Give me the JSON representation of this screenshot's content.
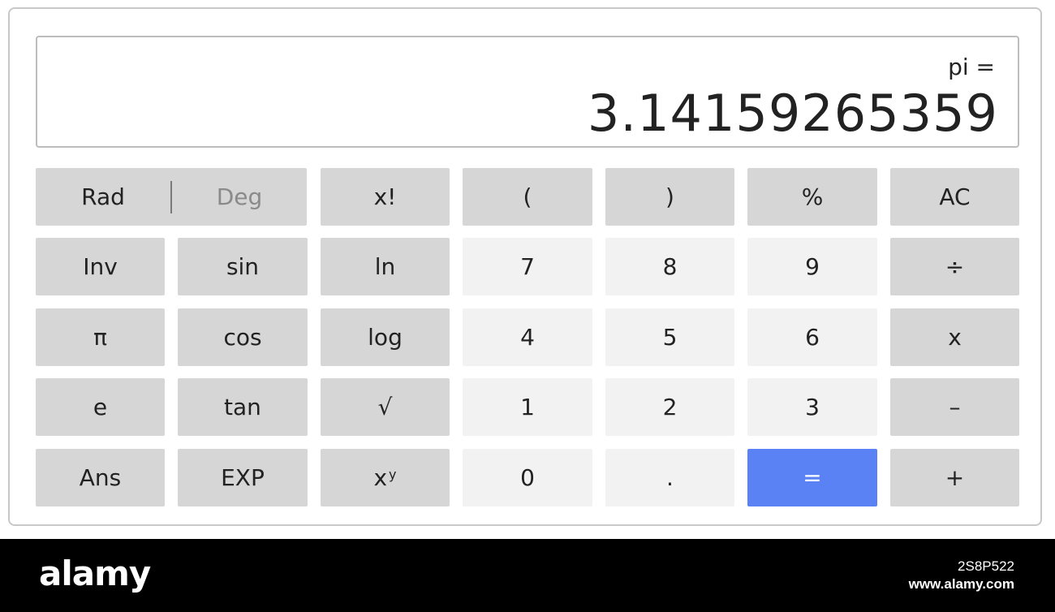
{
  "display": {
    "expression": "pi =",
    "result": "3.14159265359"
  },
  "angle_mode": {
    "rad_label": "Rad",
    "deg_label": "Deg"
  },
  "keys": {
    "factorial": "x!",
    "open_paren": "(",
    "close_paren": ")",
    "percent": "%",
    "clear": "AC",
    "inv": "Inv",
    "sin": "sin",
    "ln": "ln",
    "seven": "7",
    "eight": "8",
    "nine": "9",
    "divide": "÷",
    "pi": "π",
    "cos": "cos",
    "log": "log",
    "four": "4",
    "five": "5",
    "six": "6",
    "multiply": "x",
    "e": "e",
    "tan": "tan",
    "sqrt": "√",
    "one": "1",
    "two": "2",
    "three": "3",
    "minus": "–",
    "ans": "Ans",
    "exp": "EXP",
    "power_base": "x",
    "power_sup": "y",
    "zero": "0",
    "decimal": ".",
    "equals": "=",
    "plus": "+"
  },
  "watermark": {
    "brand": "alamy",
    "image_code": "2S8P522",
    "url": "www.alamy.com"
  },
  "colors": {
    "operator_key": "#d6d6d6",
    "number_key": "#f2f2f2",
    "equals_key": "#5a82f5"
  }
}
